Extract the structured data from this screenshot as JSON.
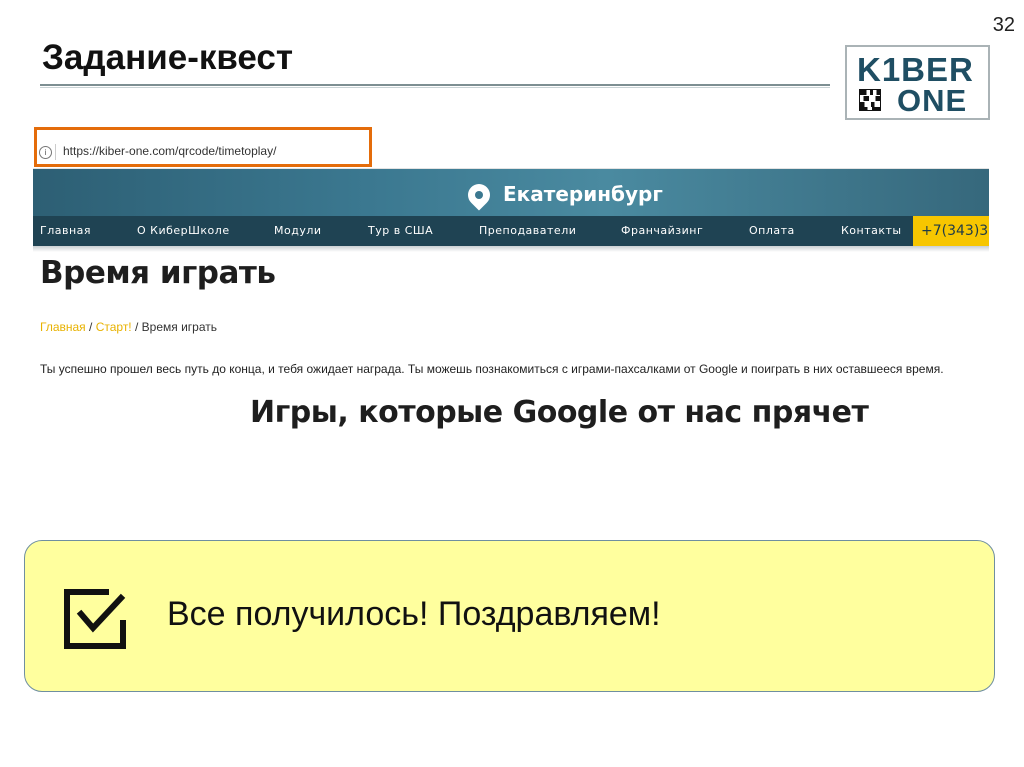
{
  "slide": {
    "number": "32",
    "title": "Задание-квест"
  },
  "logo": {
    "line1": "K1BER",
    "line2": "ONE"
  },
  "browser": {
    "address_url": "https://kiber-one.com/qrcode/timetoplay/",
    "city": "Екатеринбург",
    "nav_items": [
      "Главная",
      "О КиберШколе",
      "Модули",
      "Тур в США",
      "Преподаватели",
      "Франчайзинг",
      "Оплата",
      "Контакты"
    ],
    "phone": "+7(343)3",
    "page_heading": "Время играть",
    "breadcrumb": {
      "home": "Главная",
      "sep1": " / ",
      "start": "Старт!",
      "sep2": " / ",
      "current": "Время играть"
    },
    "intro_text": "Ты успешно прошел весь путь до конца, и тебя ожидает награда. Ты можешь познакомиться с играми-пахсалками от Google и поиграть в них оставшееся время.",
    "games_heading": "Игры, которые Google от нас прячет"
  },
  "callout": {
    "text": "Все получилось! Поздравляем!",
    "icon": "checkbox-icon"
  },
  "colors": {
    "highlight": "#e46c0a",
    "nav_bg": "#1f4353",
    "phone_bg": "#f7c600",
    "callout_bg": "#ffff9e",
    "link": "#e8b200"
  }
}
